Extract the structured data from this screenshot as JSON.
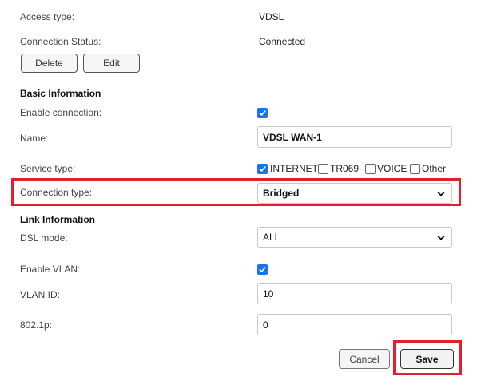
{
  "access": {
    "label": "Access type:",
    "value": "VDSL"
  },
  "status": {
    "label": "Connection Status:",
    "value": "Connected"
  },
  "actions": {
    "delete_label": "Delete",
    "edit_label": "Edit"
  },
  "basic": {
    "title": "Basic Information",
    "enable_label": "Enable connection:",
    "enable_checked": true,
    "name_label": "Name:",
    "name_value": "VDSL WAN-1",
    "service_label": "Service type:",
    "service_options": [
      {
        "label": "INTERNET",
        "checked": true
      },
      {
        "label": "TR069",
        "checked": false
      },
      {
        "label": "VOICE",
        "checked": false
      },
      {
        "label": "Other",
        "checked": false
      }
    ],
    "conn_type_label": "Connection type:",
    "conn_type_value": "Bridged"
  },
  "link": {
    "title": "Link Information",
    "dsl_label": "DSL mode:",
    "dsl_value": "ALL",
    "vlan_label": "Enable VLAN:",
    "vlan_checked": true,
    "vlan_id_label": "VLAN ID:",
    "vlan_id_value": "10",
    "p8021_label": "802.1p:",
    "p8021_value": "0"
  },
  "footer": {
    "cancel_label": "Cancel",
    "save_label": "Save"
  },
  "colors": {
    "highlight": "#e0202e",
    "checkbox": "#1a73e8"
  }
}
